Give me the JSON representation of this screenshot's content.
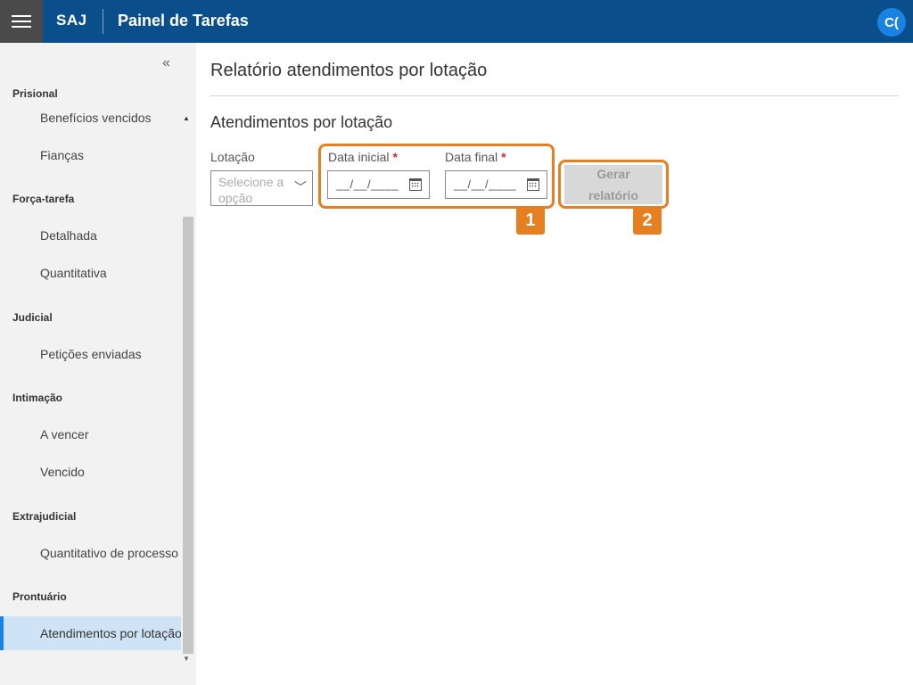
{
  "header": {
    "brand": "SAJ",
    "title": "Painel de Tarefas",
    "user_initials": "C("
  },
  "sidebar": {
    "sections": [
      {
        "label": "Prisional",
        "items": [
          "Benefícios vencidos",
          "Fianças"
        ]
      },
      {
        "label": "Força-tarefa",
        "items": [
          "Detalhada",
          "Quantitativa"
        ]
      },
      {
        "label": "Judicial",
        "items": [
          "Petições enviadas"
        ]
      },
      {
        "label": "Intimação",
        "items": [
          "A vencer",
          "Vencido"
        ]
      },
      {
        "label": "Extrajudicial",
        "items": [
          "Quantitativo de processo"
        ]
      },
      {
        "label": "Prontuário",
        "items": [
          "Atendimentos por lotação"
        ]
      }
    ],
    "active_item": "Atendimentos por lotação"
  },
  "main": {
    "page_title": "Relatório atendimentos por lotação",
    "section_title": "Atendimentos por lotação",
    "form": {
      "lotacao_label": "Lotação",
      "lotacao_placeholder": "Selecione a opção",
      "data_inicial_label": "Data inicial",
      "data_final_label": "Data final",
      "required_mark": "*",
      "date_mask": "__/__/____",
      "generate_button": "Gerar relatório"
    }
  },
  "annotations": {
    "badge_1": "1",
    "badge_2": "2",
    "color": "#e67e22"
  },
  "colors": {
    "header": "#0a4f8c",
    "accent": "#1a82e2",
    "active_item_bg": "#cfe3f7",
    "required": "#d9262e"
  }
}
